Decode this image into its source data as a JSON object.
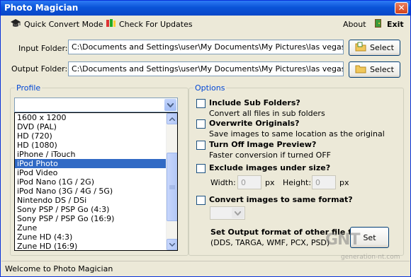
{
  "window": {
    "title": "Photo Magician",
    "close": "✕"
  },
  "menu": {
    "quick_convert": "Quick Convert Mode",
    "check_updates": "Check For Updates",
    "about": "About",
    "exit": "Exit"
  },
  "input_folder": {
    "label": "Input Folder:",
    "value": "C:\\Documents and Settings\\user\\My Documents\\My Pictures\\las vegas",
    "button": "Select"
  },
  "output_folder": {
    "label": "Output Folder:",
    "value": "C:\\Documents and Settings\\user\\My Documents\\My Pictures\\las vegas\\New F",
    "button": "Select"
  },
  "profile": {
    "title": "Profile",
    "selected": "",
    "items": [
      "1600 x 1200",
      "DVD (PAL)",
      "HD (720)",
      "HD (1080)",
      "iPhone / iTouch",
      "iPod Photo",
      "iPod Video",
      "iPod Nano (1G / 2G)",
      "iPod Nano (3G / 4G / 5G)",
      "Nintendo DS / DSi",
      "Sony PSP / PSP Go (4:3)",
      "Sony PSP / PSP Go (16:9)",
      "Zune",
      "Zune HD (4:3)",
      "Zune HD (16:9)"
    ],
    "highlighted": "iPod Photo"
  },
  "options": {
    "title": "Options",
    "include_sub": {
      "title": "Include Sub Folders?",
      "desc": "Convert all files in sub folders"
    },
    "overwrite": {
      "title": "Overwrite Originals?",
      "desc": "Save images to same location as the original"
    },
    "preview": {
      "title": "Turn Off Image Preview?",
      "desc": "Faster conversion if turned OFF"
    },
    "exclude": {
      "title": "Exclude images under size?",
      "width_label": "Width:",
      "width_value": "0",
      "width_unit": "px",
      "height_label": "Height:",
      "height_value": "0",
      "height_unit": "px"
    },
    "convert_format": {
      "title": "Convert images to same format?"
    },
    "output_format": {
      "title": "Set Output format of other file types",
      "desc": "(DDS, TARGA, WMF, PCX, PSD)",
      "button": "Set"
    }
  },
  "status": "Welcome to Photo Magician",
  "watermark": {
    "logo": "GNT",
    "url": "generation-nt.com"
  }
}
